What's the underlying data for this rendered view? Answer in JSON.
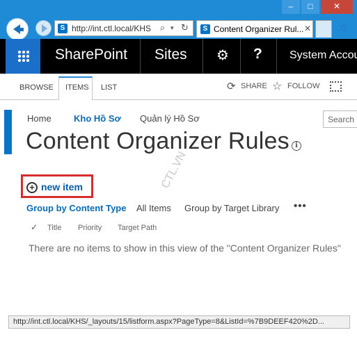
{
  "window": {
    "minimize_glyph": "–",
    "maximize_glyph": "□",
    "close_glyph": "✕"
  },
  "browser": {
    "address": "http://int.ctl.local/KHS",
    "tab_title": "Content Organizer Rul...",
    "tab_close": "✕",
    "favicon": "S",
    "search_glyph": "⌕",
    "dropdown_glyph": "▾",
    "refresh_glyph": "↻",
    "home_glyph": "⌂"
  },
  "suite": {
    "brand": "SharePoint",
    "sites": "Sites",
    "gear_glyph": "⚙",
    "help_glyph": "?",
    "account": "System Accou"
  },
  "ribbon": {
    "tabs": [
      "BROWSE",
      "ITEMS",
      "LIST"
    ],
    "share": "SHARE",
    "follow": "FOLLOW",
    "share_glyph": "⟳",
    "follow_glyph": "☆"
  },
  "nav": {
    "home": "Home",
    "kho_ho_so": "Kho Hồ Sơ",
    "quan_ly_ho_so": "Quản lý Hồ Sơ",
    "search_placeholder": "Search"
  },
  "page": {
    "title": "Content Organizer Rules",
    "info_glyph": "i",
    "watermark": "CTL.VN"
  },
  "list": {
    "new_item": "new item",
    "plus_glyph": "+",
    "views": [
      "Group by Content Type",
      "All Items",
      "Group by Target Library"
    ],
    "more": "•••",
    "check_glyph": "✓",
    "columns": [
      "Title",
      "Priority",
      "Target Path"
    ],
    "empty_message": "There are no items to show in this view of the \"Content Organizer Rules\""
  },
  "status_bar": "http://int.ctl.local/KHS/_layouts/15/listform.aspx?PageType=8&ListId=%7B9DEEF420%2D..."
}
